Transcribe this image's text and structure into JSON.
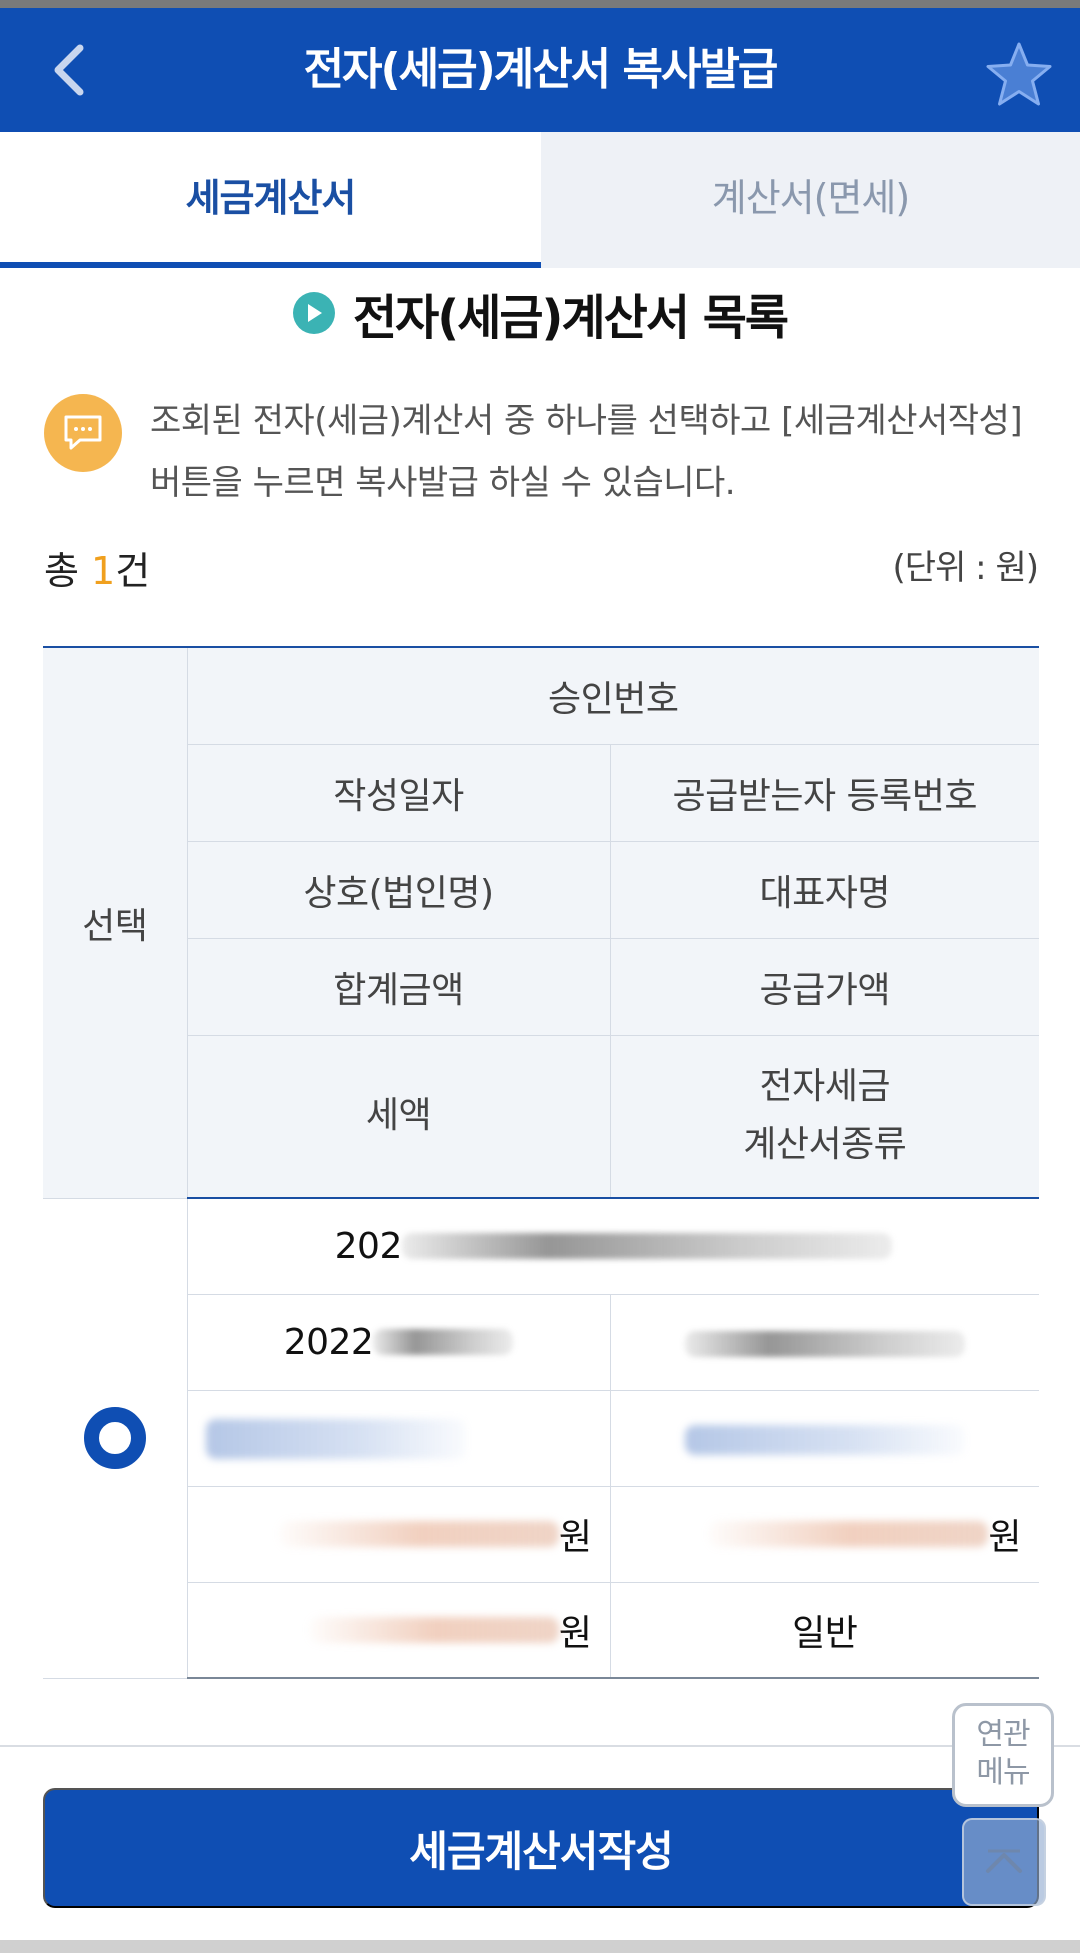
{
  "header": {
    "title": "전자(세금)계산서 복사발급",
    "back_icon": "chevron-left-icon",
    "favorite_icon": "star-icon",
    "favorite_color": "#4a7fd4"
  },
  "tabs": [
    {
      "label": "세금계산서",
      "active": true
    },
    {
      "label": "계산서(면세)",
      "active": false
    }
  ],
  "section": {
    "title": "전자(세금)계산서 목록",
    "icon": "play-circle-icon"
  },
  "notice": {
    "icon": "chat-bubble-icon",
    "text": "조회된 전자(세금)계산서 중 하나를 선택하고 [세금계산서작성]버튼을 누르면 복사발급 하실 수 있습니다."
  },
  "summary": {
    "total_prefix": "총 ",
    "total_count": "1",
    "total_suffix": "건",
    "unit": "(단위 : 원)"
  },
  "table": {
    "headers": {
      "select": "선택",
      "approval_no": "승인번호",
      "write_date": "작성일자",
      "recipient_reg_no": "공급받는자 등록번호",
      "company_name": "상호(법인명)",
      "representative": "대표자명",
      "total_amount": "합계금액",
      "supply_amount": "공급가액",
      "tax_amount": "세액",
      "invoice_type_line1": "전자세금",
      "invoice_type_line2": "계산서종류"
    },
    "rows": [
      {
        "selected": true,
        "approval_no_visible": "202",
        "write_date_visible": "2022",
        "total_amount_unit": "원",
        "supply_amount_unit": "원",
        "tax_amount_unit": "원",
        "invoice_type": "일반"
      }
    ]
  },
  "buttons": {
    "create_invoice": "세금계산서작성",
    "related_menu_line1": "연관",
    "related_menu_line2": "메뉴",
    "scroll_top_icon": "chevron-up-icon"
  },
  "colors": {
    "primary": "#0f4eb3",
    "accent_count": "#f0a01e",
    "notice_icon_bg": "#f5b650",
    "section_icon_bg": "#3bb3b4"
  }
}
